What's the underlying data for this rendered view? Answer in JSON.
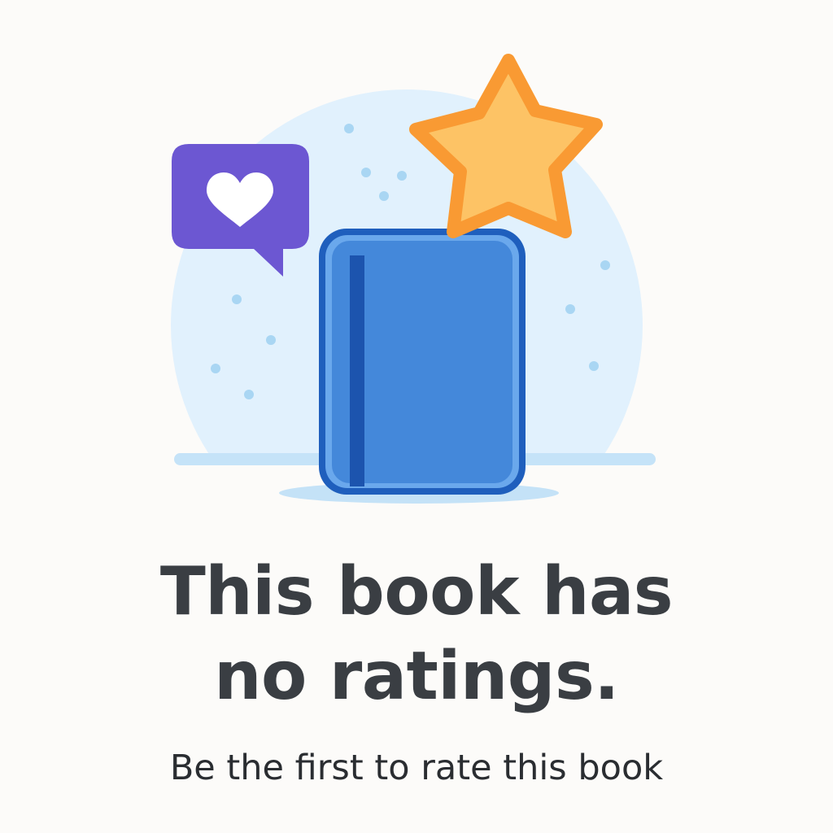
{
  "empty_state": {
    "headline_line1": "This book has",
    "headline_line2": "no ratings.",
    "subtitle": "Be the first to rate this book"
  },
  "icons": {
    "illustration": "empty-ratings-illustration",
    "book": "book-icon",
    "star": "star-icon",
    "speech_bubble": "speech-bubble-heart-icon"
  },
  "colors": {
    "background": "#fcfbf9",
    "circle": "#e1f1fd",
    "book_fill": "#4488da",
    "book_outline": "#1f5fbd",
    "star_fill": "#fdc365",
    "star_outline": "#f99a33",
    "bubble": "#6c57d2",
    "headline": "#3a3e43",
    "subtitle": "#2a2d31"
  }
}
